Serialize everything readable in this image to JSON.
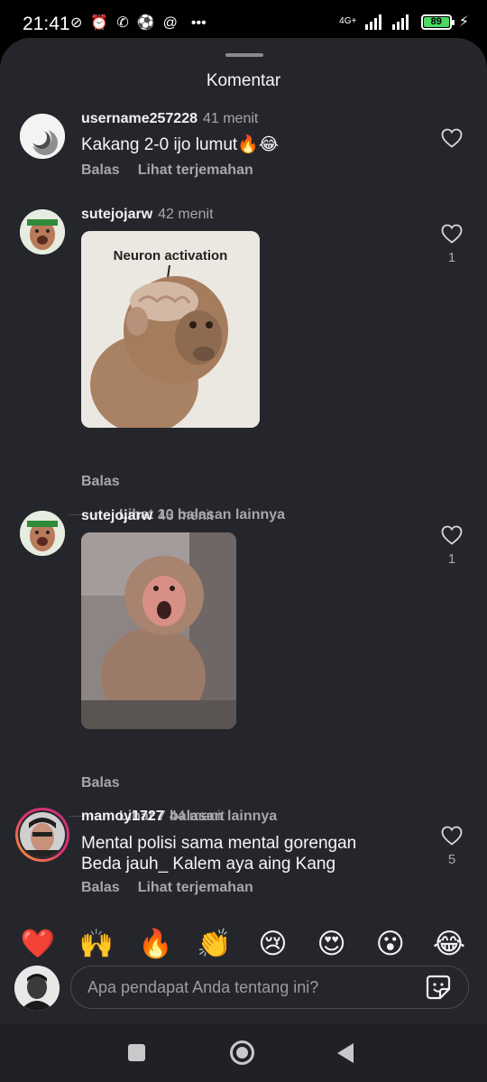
{
  "status_bar": {
    "time": "21:41",
    "network_label": "4G+",
    "battery_level": "89",
    "battery_color": "#4cd964",
    "left_icons": [
      "muted-vibrate-icon",
      "alarm-icon",
      "whatsapp-icon",
      "soccer-ball-icon",
      "at-sign-icon",
      "more-dots-icon"
    ],
    "right_icons": [
      "signal-icon",
      "signal-icon",
      "battery-icon",
      "charging-icon"
    ]
  },
  "sheet": {
    "title": "Komentar"
  },
  "comments": [
    {
      "username": "username257228",
      "time": "41 menit",
      "text": "Kakang 2-0 ijo lumut🔥😂",
      "reply_label": "Balas",
      "translate_label": "Lihat terjemahan",
      "like_count": ""
    },
    {
      "username": "sutejojarw",
      "time": "42 menit",
      "media_text": "Neuron activation",
      "reply_label": "Balas",
      "like_count": "1",
      "more_replies": "Lihat 10 balasan lainnya"
    },
    {
      "username": "sutejojarw",
      "time": "43 menit",
      "reply_label": "Balas",
      "like_count": "1",
      "more_replies": "Lihat 7 balasan lainnya"
    },
    {
      "username": "mamoy1727",
      "time": "44 menit",
      "text_line1": "Mental polisi sama mental gorengan",
      "text_line2": "Beda jauh_ Kalem aya aing Kang",
      "reply_label": "Balas",
      "translate_label": "Lihat terjemahan",
      "like_count": "5"
    }
  ],
  "emoji_bar": [
    "❤️",
    "🙌",
    "🔥",
    "👏",
    "😢",
    "😍",
    "😮",
    "😂"
  ],
  "input": {
    "placeholder": "Apa pendapat Anda tentang ini?"
  },
  "colors": {
    "sheet_bg": "#25262b",
    "secondary_text": "#a6a7ab",
    "story_ring": "#c13584"
  }
}
